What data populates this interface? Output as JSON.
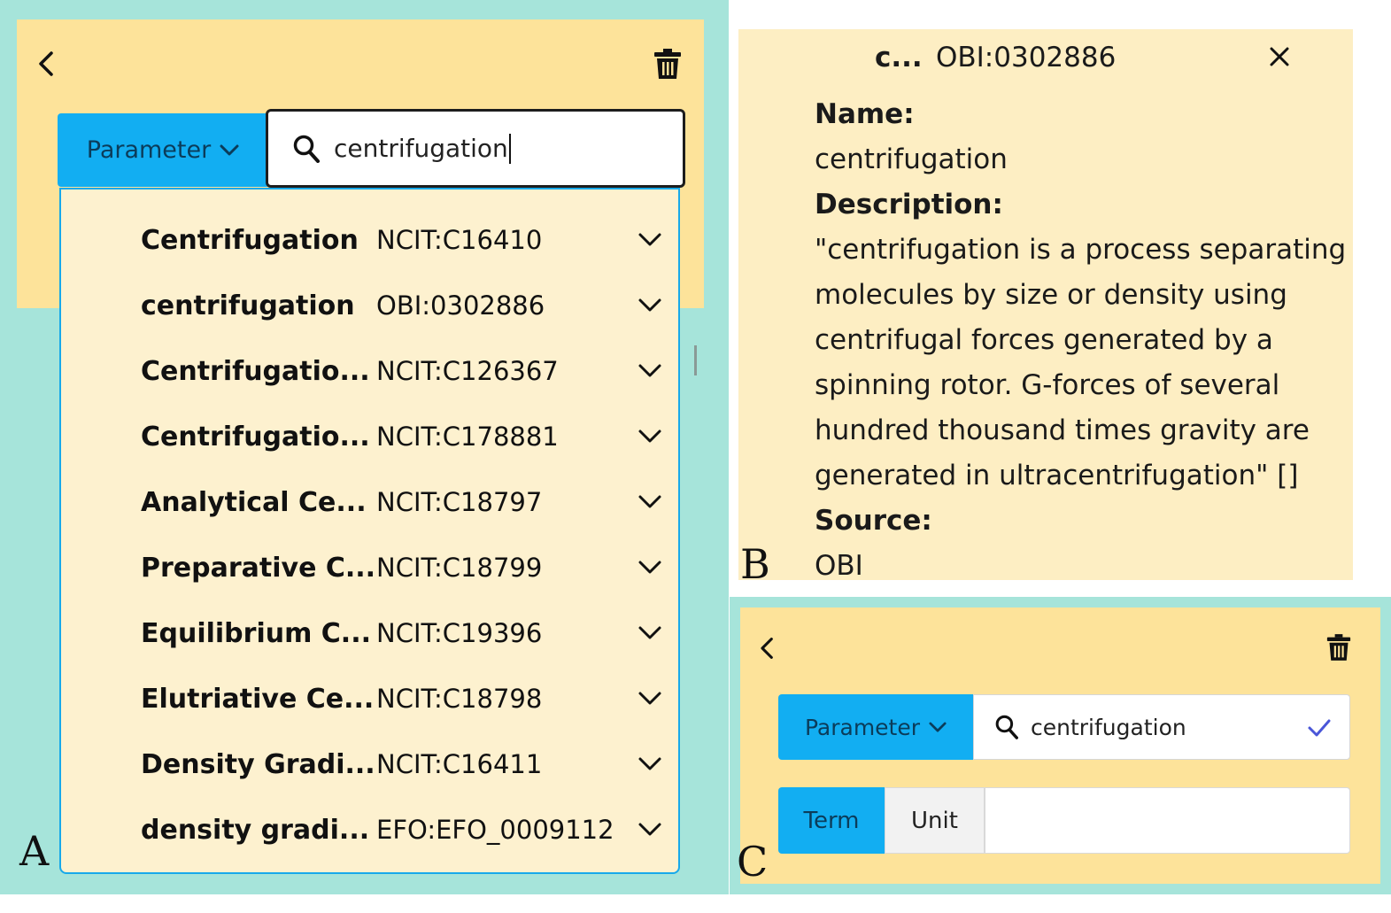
{
  "panel_a": {
    "label": "A",
    "category_button": "Parameter",
    "search": {
      "value": "centrifugation"
    },
    "results": [
      {
        "name": "Centrifugation",
        "id": "NCIT:C16410"
      },
      {
        "name": "centrifugation",
        "id": "OBI:0302886"
      },
      {
        "name": "Centrifugatio...",
        "id": "NCIT:C126367"
      },
      {
        "name": "Centrifugatio...",
        "id": "NCIT:C178881"
      },
      {
        "name": "Analytical Ce...",
        "id": "NCIT:C18797"
      },
      {
        "name": "Preparative C...",
        "id": "NCIT:C18799"
      },
      {
        "name": "Equilibrium C...",
        "id": "NCIT:C19396"
      },
      {
        "name": "Elutriative Ce...",
        "id": "NCIT:C18798"
      },
      {
        "name": "Density Gradi...",
        "id": "NCIT:C16411"
      },
      {
        "name": "density gradi...",
        "id": "EFO:EFO_0009112"
      }
    ]
  },
  "panel_b": {
    "label": "B",
    "header_abbrev": "c...",
    "header_id": "OBI:0302886",
    "name_label": "Name:",
    "name_value": "centrifugation",
    "description_label": "Description:",
    "description_lines": [
      "\"centrifugation is a process separating",
      "molecules by size or density using",
      "centrifugal forces generated by a",
      "spinning rotor. G-forces of several",
      "hundred thousand times gravity are",
      "generated in ultracentrifugation\" []"
    ],
    "source_label": "Source:",
    "source_value": "OBI"
  },
  "panel_c": {
    "label": "C",
    "category_button": "Parameter",
    "search": {
      "value": "centrifugation"
    },
    "tab_term": "Term",
    "tab_unit": "Unit"
  },
  "colors": {
    "panel_bg": "#a6e4da",
    "header_bg": "#fde39a",
    "dropdown_bg": "#fdf1cf",
    "accent": "#12aef2",
    "check": "#4a56d8"
  },
  "icons": [
    "chevron-left-icon",
    "trash-icon",
    "search-icon",
    "chevron-down-icon",
    "close-icon",
    "checkmark-icon"
  ]
}
